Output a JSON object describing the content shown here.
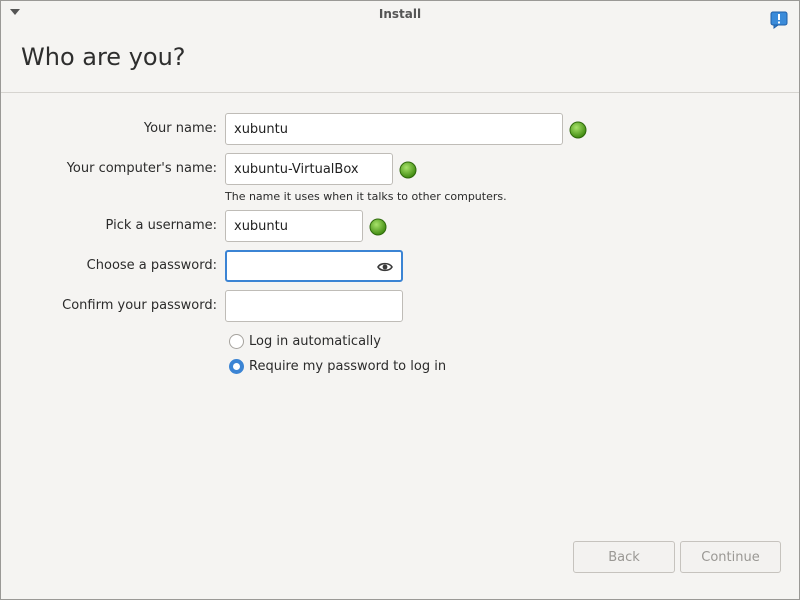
{
  "window": {
    "title": "Install",
    "heading": "Who are you?"
  },
  "form": {
    "name_label": "Your name:",
    "name_value": "xubuntu",
    "computer_label": "Your computer's name:",
    "computer_value": "xubuntu-VirtualBox",
    "computer_hint": "The name it uses when it talks to other computers.",
    "username_label": "Pick a username:",
    "username_value": "xubuntu",
    "password_label": "Choose a password:",
    "password_value": "",
    "confirm_label": "Confirm your password:",
    "confirm_value": ""
  },
  "login": {
    "auto_label": "Log in automatically",
    "require_label": "Require my password to log in",
    "selected": "require"
  },
  "buttons": {
    "back": "Back",
    "continue": "Continue"
  },
  "colors": {
    "accent": "#3b84d4",
    "ok_green": "#5fb81c",
    "info_blue": "#3b8bd9"
  }
}
